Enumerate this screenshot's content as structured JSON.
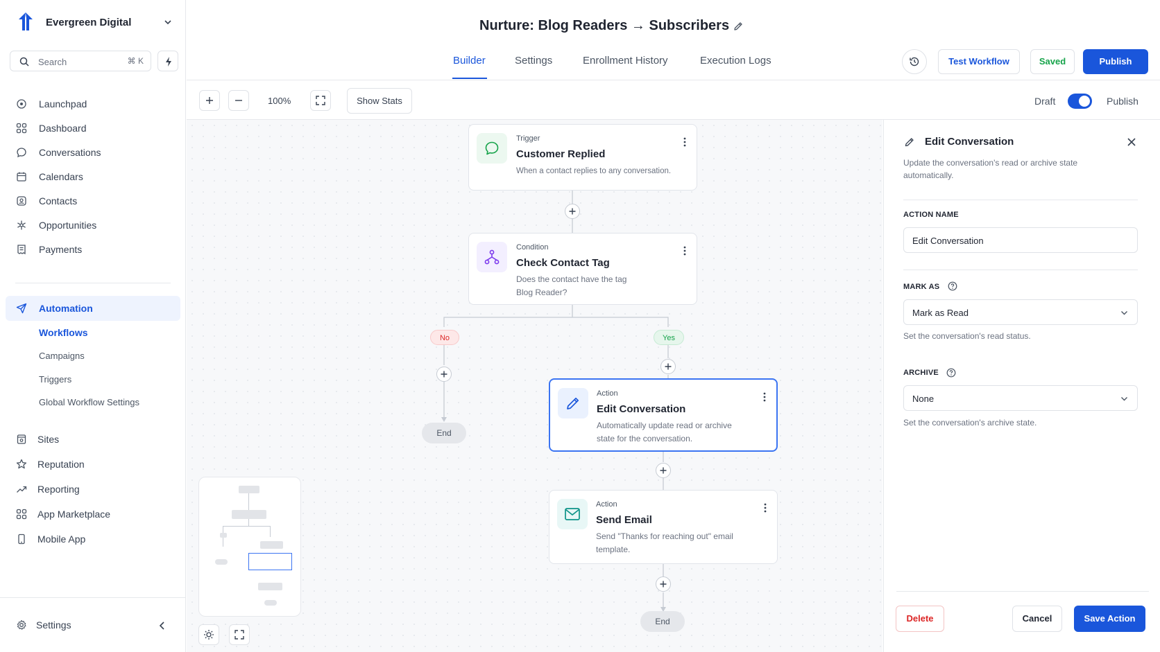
{
  "app": {
    "org_name": "Evergreen Digital"
  },
  "search": {
    "placeholder": "Search",
    "shortcut": "⌘ K"
  },
  "sidebar": {
    "items": [
      {
        "label": "Launchpad",
        "icon": "rocket-icon"
      },
      {
        "label": "Dashboard",
        "icon": "grid-icon"
      },
      {
        "label": "Conversations",
        "icon": "chat-icon"
      },
      {
        "label": "Calendars",
        "icon": "calendar-icon"
      },
      {
        "label": "Contacts",
        "icon": "contacts-icon"
      },
      {
        "label": "Opportunities",
        "icon": "asterisk-icon"
      },
      {
        "label": "Payments",
        "icon": "receipt-icon"
      }
    ],
    "automation": {
      "label": "Automation",
      "icon": "send-icon",
      "children": [
        "Workflows",
        "Campaigns",
        "Triggers",
        "Global Workflow Settings"
      ]
    },
    "items2": [
      {
        "label": "Sites",
        "icon": "sites-icon"
      },
      {
        "label": "Reputation",
        "icon": "star-icon"
      },
      {
        "label": "Reporting",
        "icon": "trend-icon"
      },
      {
        "label": "App Marketplace",
        "icon": "apps-icon"
      },
      {
        "label": "Mobile App",
        "icon": "phone-icon"
      }
    ],
    "settings_label": "Settings"
  },
  "header": {
    "title": "Nurture: Blog Readers → Subscribers",
    "tabs": [
      "Builder",
      "Settings",
      "Enrollment History",
      "Execution Logs"
    ],
    "active_tab": "Builder",
    "test_button": "Test Workflow",
    "saved_button": "Saved",
    "publish_button": "Publish"
  },
  "toolbar": {
    "zoom": "100%",
    "show_stats": "Show Stats",
    "draft_label": "Draft",
    "publish_label": "Publish",
    "publish_toggle_on": true
  },
  "workflow": {
    "trigger": {
      "kind": "Trigger",
      "title": "Customer Replied",
      "desc": "When a contact replies to any conversation."
    },
    "condition": {
      "kind": "Condition",
      "title": "Check Contact Tag",
      "desc_line1": "Does the contact have the tag",
      "desc_line2": "Blog Reader?"
    },
    "branch_no": "No",
    "branch_yes": "Yes",
    "action1": {
      "kind": "Action",
      "title": "Edit Conversation",
      "desc_line1": "Automatically update read or archive",
      "desc_line2": "state for the conversation."
    },
    "action2": {
      "kind": "Action",
      "title": "Send Email",
      "desc_line1": "Send \"Thanks for reaching out\" email",
      "desc_line2": "template."
    },
    "end_label": "End"
  },
  "panel": {
    "title": "Edit Conversation",
    "desc": "Update the conversation's read or archive state automatically.",
    "action_name_label": "ACTION NAME",
    "action_name_value": "Edit Conversation",
    "mark_as_label": "MARK AS",
    "mark_as_value": "Mark as Read",
    "mark_as_help": "Set the conversation's read status.",
    "archive_label": "ARCHIVE",
    "archive_value": "None",
    "archive_help": "Set the conversation's archive state.",
    "delete_button": "Delete",
    "cancel_button": "Cancel",
    "save_button": "Save Action"
  },
  "colors": {
    "accent": "#1a56db",
    "saved": "#16a34a",
    "danger": "#dc2626"
  }
}
